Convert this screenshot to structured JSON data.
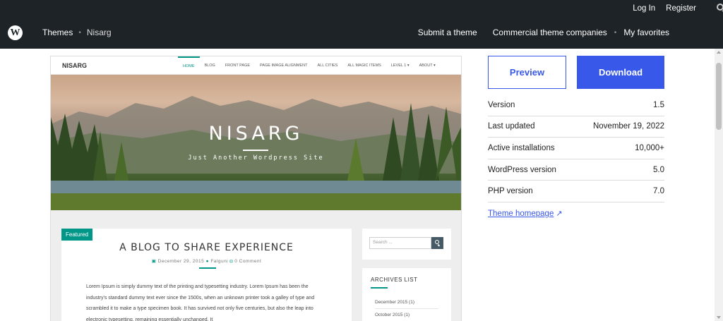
{
  "topbar": {
    "login": "Log In",
    "register": "Register",
    "search_icon": "search-icon",
    "logo_icon": "wordpress-logo-icon",
    "logo_glyph": "W",
    "breadcrumbs": [
      "Themes",
      "Nisarg"
    ],
    "nav": [
      "Submit a theme",
      "Commercial theme companies",
      "My favorites"
    ],
    "separator": "•"
  },
  "preview": {
    "site_logo": "NISARG",
    "menu": [
      "HOME",
      "BLOG",
      "FRONT PAGE",
      "PAGE IMAGE ALIGNMENT",
      "ALL CITIES",
      "ALL MAGIC ITEMS",
      "LEVEL 1 ▾",
      "ABOUT ▾"
    ],
    "hero_title": "NISARG",
    "hero_tagline": "Just Another Wordpress Site",
    "featured_badge": "Featured",
    "post_title": "A BLOG TO SHARE EXPERIENCE",
    "post_date": "December 29, 2015",
    "post_author": "Falguni",
    "post_comments": "0 Comment",
    "post_body": "Lorem Ipsum is simply dummy text of the printing and typesetting industry. Lorem Ipsum has been the industry's standard dummy text ever since the 1500s, when an unknown printer took a galley of type and scrambled it to make a type specimen book. It has survived not only five centuries, but also the leap into electronic typesetting, remaining essentially unchanged. It",
    "search_placeholder": "Search ...",
    "archives_title": "ARCHIVES LIST",
    "archives": [
      "December 2015 (1)",
      "October 2015 (1)"
    ],
    "accent_color": "#009688"
  },
  "actions": {
    "preview": "Preview",
    "download": "Download",
    "primary_color": "#3858e9"
  },
  "meta": [
    {
      "label": "Version",
      "value": "1.5"
    },
    {
      "label": "Last updated",
      "value": "November 19, 2022"
    },
    {
      "label": "Active installations",
      "value": "10,000+"
    },
    {
      "label": "WordPress version",
      "value": "5.0"
    },
    {
      "label": "PHP version",
      "value": "7.0"
    }
  ],
  "theme_homepage": {
    "label": "Theme homepage",
    "arrow": "↗"
  }
}
